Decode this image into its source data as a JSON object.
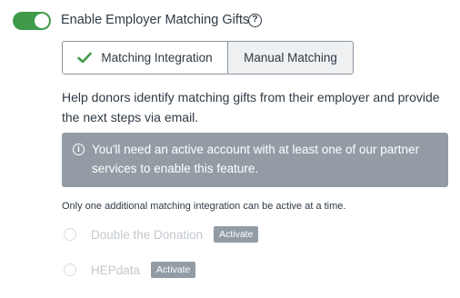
{
  "matching": {
    "toggle_label": "Enable Employer Matching Gifts",
    "toggle_on": true,
    "help_icon": "question-circle-icon",
    "help_glyph": "?"
  },
  "tabs": [
    {
      "label": "Matching Integration",
      "active": true,
      "icon": "check-icon"
    },
    {
      "label": "Manual Matching",
      "active": false
    }
  ],
  "description": "Help donors identify matching gifts from their employer and provide the next steps via email.",
  "alert": {
    "icon": "info-circle-icon",
    "icon_glyph": "i",
    "text": "You'll need an active account with at least one of our partner services to enable this feature."
  },
  "note": "Only one additional matching integration can be active at a time.",
  "integrations": [
    {
      "name": "Double the Donation",
      "button_label": "Activate"
    },
    {
      "name": "HEPdata",
      "button_label": "Activate"
    }
  ],
  "colors": {
    "toggle_on": "#3f9b49",
    "check": "#3f9b49",
    "alert_bg": "#939ca5",
    "text": "#2f3a45",
    "disabled_text": "#c3c8cd"
  }
}
